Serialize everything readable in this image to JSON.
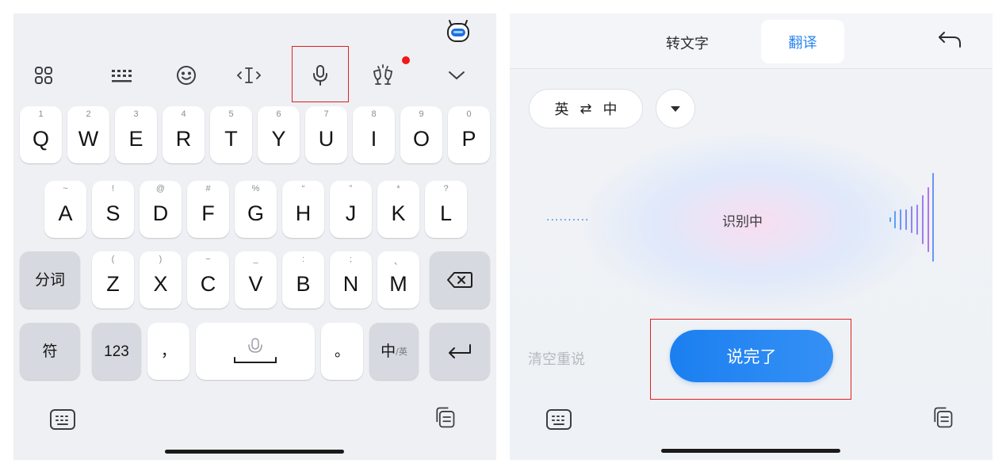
{
  "keyboard": {
    "toolbar": {
      "icons": [
        "apps-grid-icon",
        "keyboard-layout-icon",
        "emoji-icon",
        "cursor-move-icon",
        "microphone-icon",
        "cheers-icon",
        "collapse-chevron-icon"
      ],
      "has_notification_dot": true,
      "mascot_icon": "mascot-icon"
    },
    "rows": [
      [
        {
          "main": "Q",
          "sub": "1"
        },
        {
          "main": "W",
          "sub": "2"
        },
        {
          "main": "E",
          "sub": "3"
        },
        {
          "main": "R",
          "sub": "4"
        },
        {
          "main": "T",
          "sub": "5"
        },
        {
          "main": "Y",
          "sub": "6"
        },
        {
          "main": "U",
          "sub": "7"
        },
        {
          "main": "I",
          "sub": "8"
        },
        {
          "main": "O",
          "sub": "9"
        },
        {
          "main": "P",
          "sub": "0"
        }
      ],
      [
        {
          "main": "A",
          "sub": "~"
        },
        {
          "main": "S",
          "sub": "!"
        },
        {
          "main": "D",
          "sub": "@"
        },
        {
          "main": "F",
          "sub": "#"
        },
        {
          "main": "G",
          "sub": "%"
        },
        {
          "main": "H",
          "sub": "“"
        },
        {
          "main": "J",
          "sub": "”"
        },
        {
          "main": "K",
          "sub": "*"
        },
        {
          "main": "L",
          "sub": "?"
        }
      ],
      [
        {
          "main": "Z",
          "sub": "("
        },
        {
          "main": "X",
          "sub": ")"
        },
        {
          "main": "C",
          "sub": "−"
        },
        {
          "main": "V",
          "sub": "_"
        },
        {
          "main": "B",
          "sub": ":"
        },
        {
          "main": "N",
          "sub": ";"
        },
        {
          "main": "M",
          "sub": "、"
        }
      ]
    ],
    "fn": {
      "segment": "分词",
      "symbols": "符",
      "numbers": "123",
      "comma": "，",
      "period": "。",
      "lang_main": "中",
      "lang_sub": "/英"
    }
  },
  "voice": {
    "tabs": {
      "transcribe": "转文字",
      "translate": "翻译"
    },
    "active_tab": "翻译",
    "lang": {
      "source": "英",
      "swap": "⇄",
      "target": "中"
    },
    "status": "识别中",
    "dots": "··········",
    "clear_label": "清空重说",
    "done_label": "说完了"
  },
  "colors": {
    "accent": "#2b84f0",
    "highlight": "#e02020"
  }
}
